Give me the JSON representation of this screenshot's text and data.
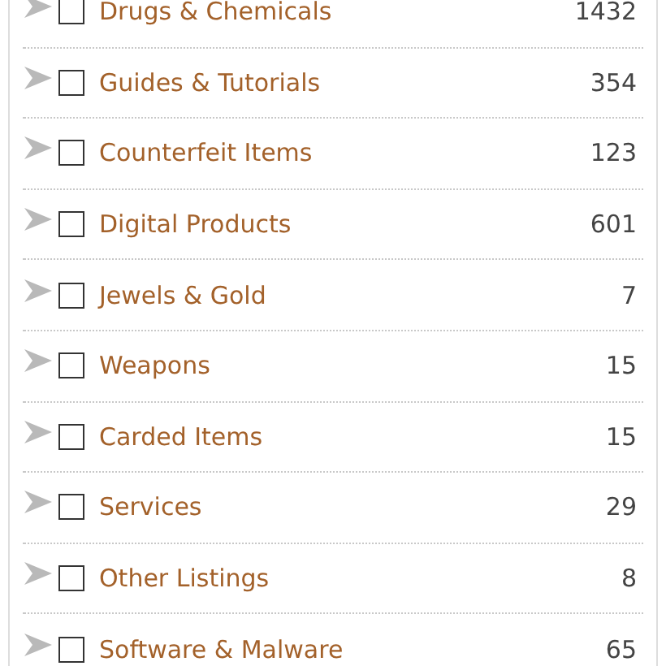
{
  "categories": [
    {
      "name": "Drugs & Chemicals",
      "count": "1432",
      "checked": false,
      "expanded": false
    },
    {
      "name": "Guides & Tutorials",
      "count": "354",
      "checked": false,
      "expanded": false
    },
    {
      "name": "Counterfeit Items",
      "count": "123",
      "checked": false,
      "expanded": false
    },
    {
      "name": "Digital Products",
      "count": "601",
      "checked": false,
      "expanded": false
    },
    {
      "name": "Jewels & Gold",
      "count": "7",
      "checked": false,
      "expanded": false
    },
    {
      "name": "Weapons",
      "count": "15",
      "checked": false,
      "expanded": false
    },
    {
      "name": "Carded Items",
      "count": "15",
      "checked": false,
      "expanded": false
    },
    {
      "name": "Services",
      "count": "29",
      "checked": false,
      "expanded": false
    },
    {
      "name": "Other Listings",
      "count": "8",
      "checked": false,
      "expanded": false
    },
    {
      "name": "Software & Malware",
      "count": "65",
      "checked": false,
      "expanded": false
    }
  ]
}
